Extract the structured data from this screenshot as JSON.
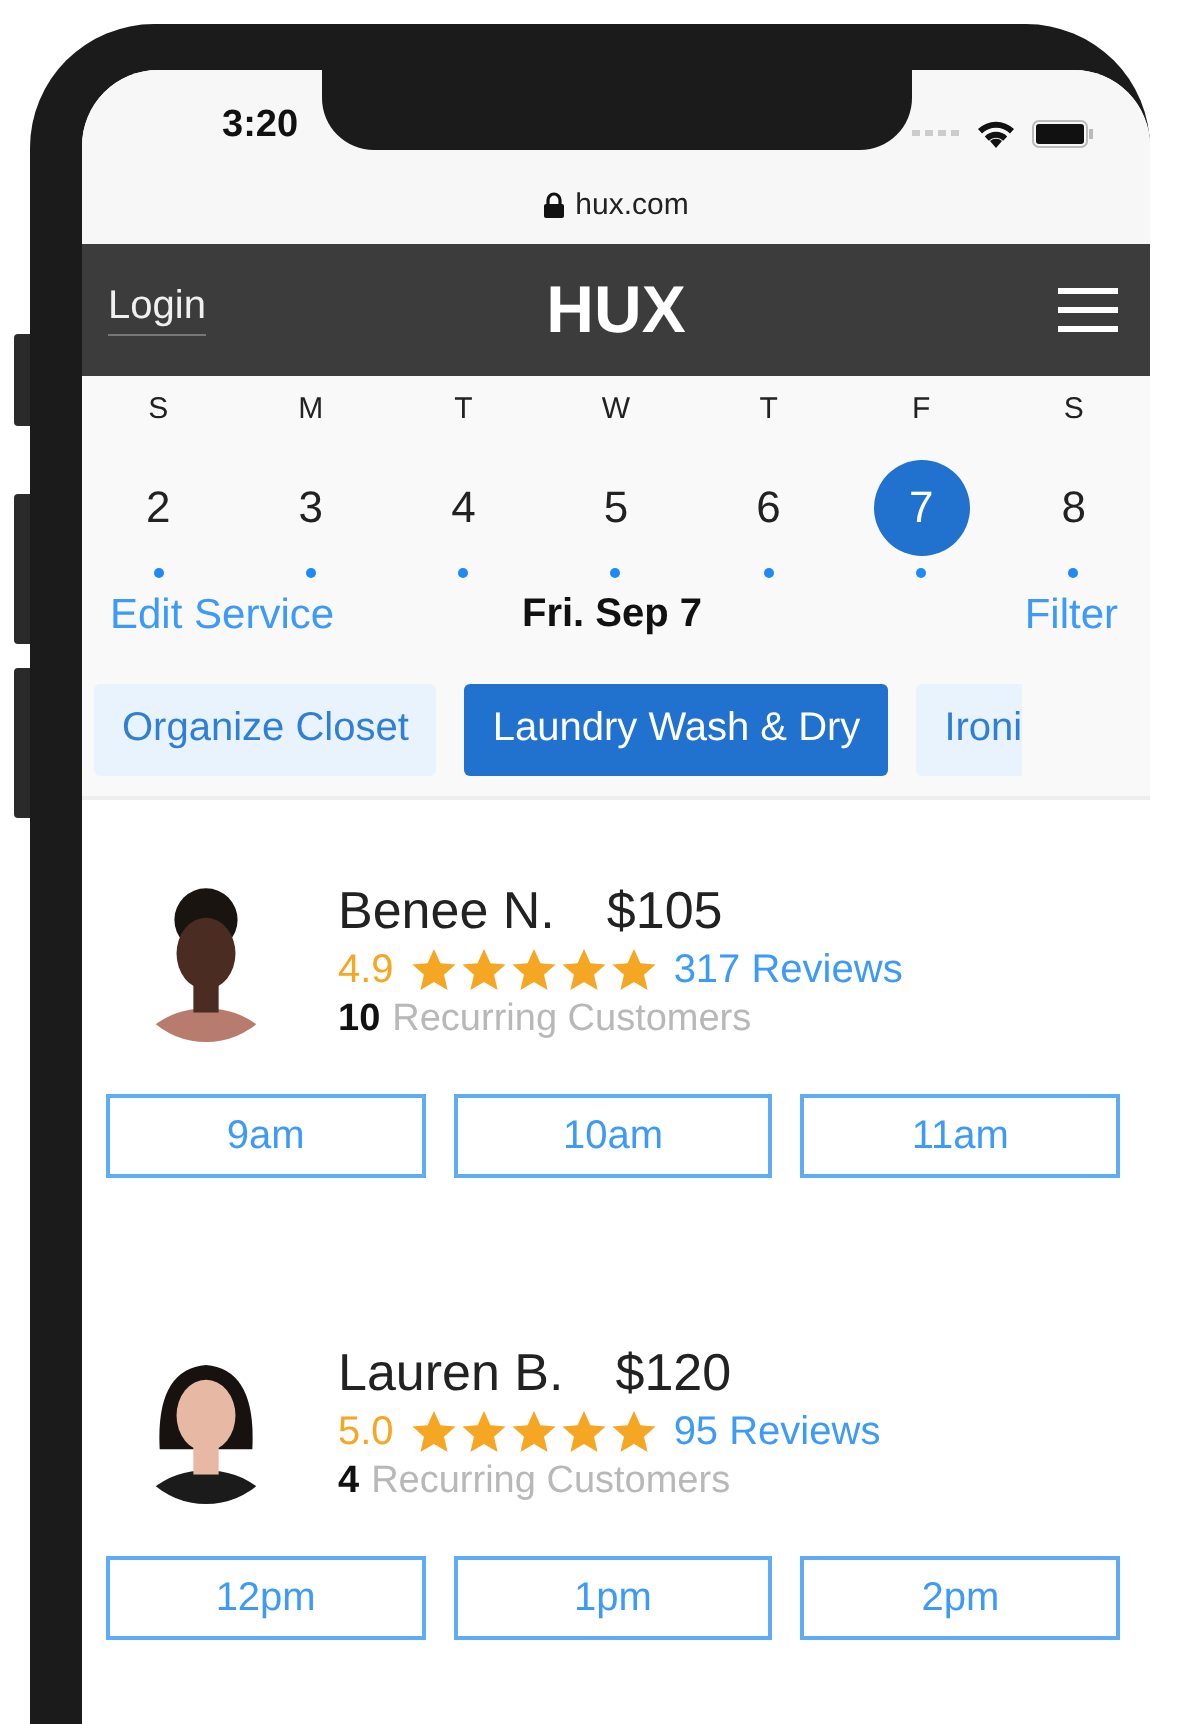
{
  "status_bar": {
    "time": "3:20"
  },
  "address_bar": {
    "url": "hux.com"
  },
  "nav": {
    "login": "Login",
    "logo": "HUX"
  },
  "calendar": {
    "days": [
      {
        "weekday": "S",
        "date": "2",
        "selected": false
      },
      {
        "weekday": "M",
        "date": "3",
        "selected": false
      },
      {
        "weekday": "T",
        "date": "4",
        "selected": false
      },
      {
        "weekday": "W",
        "date": "5",
        "selected": false
      },
      {
        "weekday": "T",
        "date": "6",
        "selected": false
      },
      {
        "weekday": "F",
        "date": "7",
        "selected": true
      },
      {
        "weekday": "S",
        "date": "8",
        "selected": false
      }
    ],
    "edit_link": "Edit Service",
    "selected_date": "Fri. Sep 7",
    "filter_link": "Filter"
  },
  "services": [
    {
      "label": "Organize Closet",
      "selected": false
    },
    {
      "label": "Laundry Wash & Dry",
      "selected": true
    },
    {
      "label": "Ironi",
      "selected": false
    }
  ],
  "providers": [
    {
      "name": "Benee N.",
      "price": "$105",
      "rating": "4.9",
      "stars": 5,
      "reviews": "317 Reviews",
      "recurring_count": "10",
      "recurring_label": "Recurring Customers",
      "slots": [
        "9am",
        "10am",
        "11am"
      ]
    },
    {
      "name": "Lauren B.",
      "price": "$120",
      "rating": "5.0",
      "stars": 5,
      "reviews": "95 Reviews",
      "recurring_count": "4",
      "recurring_label": "Recurring Customers",
      "slots": [
        "12pm",
        "1pm",
        "2pm"
      ]
    }
  ]
}
